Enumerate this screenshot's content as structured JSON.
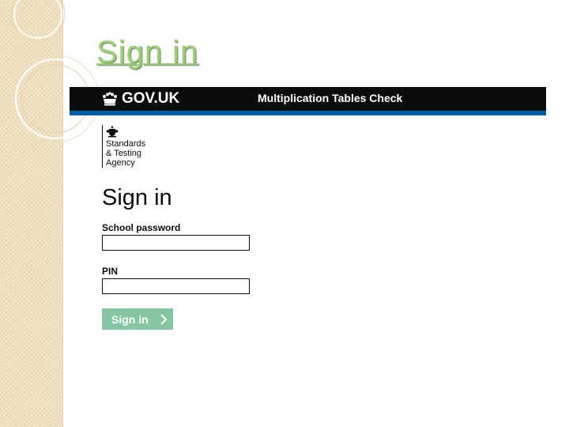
{
  "slide": {
    "title": "Sign in"
  },
  "header": {
    "logo_text": "GOV.UK",
    "service_name": "Multiplication Tables Check",
    "logo_icon": "crown-icon"
  },
  "sta_logo": {
    "icon": "royal-crest-icon",
    "lines": [
      "Standards",
      "& Testing",
      "Agency"
    ]
  },
  "form": {
    "heading": "Sign in",
    "school_password_label": "School password",
    "school_password_value": "",
    "pin_label": "PIN",
    "pin_value": "",
    "submit_label": "Sign in",
    "submit_icon": "chevron-right-icon"
  },
  "colors": {
    "title_green": "#9bd07a",
    "header_black": "#0b0c0c",
    "gov_blue": "#005ea5",
    "button_green": "#85c6a2",
    "strip_beige": "#f3e6c8"
  }
}
